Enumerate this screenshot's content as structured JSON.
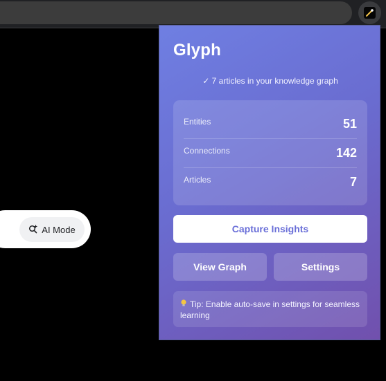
{
  "browser": {
    "extension_icon": "magic-wand-icon"
  },
  "page": {
    "ai_mode_label": "AI Mode",
    "ai_mode_icon": "sparkle-search-icon"
  },
  "popup": {
    "title": "Glyph",
    "status": "✓ 7 articles in your knowledge graph",
    "stats": [
      {
        "label": "Entities",
        "value": "51"
      },
      {
        "label": "Connections",
        "value": "142"
      },
      {
        "label": "Articles",
        "value": "7"
      }
    ],
    "capture_label": "Capture Insights",
    "view_graph_label": "View Graph",
    "settings_label": "Settings",
    "tip_icon": "lightbulb-icon",
    "tip_text": "Tip: Enable auto-save in settings for seamless learning"
  },
  "colors": {
    "popup_gradient_start": "#6f7fe2",
    "popup_gradient_end": "#7150ad",
    "capture_text": "#6a6fd8"
  }
}
